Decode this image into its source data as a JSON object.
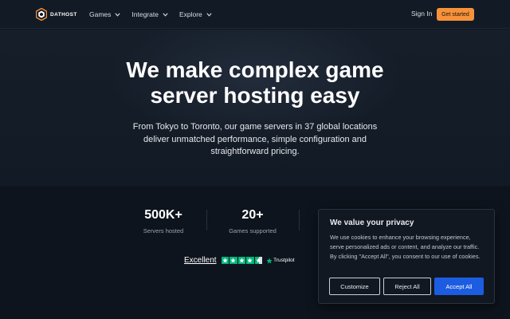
{
  "nav": {
    "brand": "DATHOST",
    "menu": [
      {
        "label": "Games"
      },
      {
        "label": "Integrate"
      },
      {
        "label": "Explore"
      }
    ],
    "sign_in": "Sign In",
    "get_started": "Get started"
  },
  "hero": {
    "title_line1": "We make complex game",
    "title_line2": "server hosting easy",
    "subtitle": "From Tokyo to Toronto, our game servers in 37 global locations deliver unmatched performance, simple configuration and straightforward pricing."
  },
  "stats": [
    {
      "value": "500K+",
      "label": "Servers hosted"
    },
    {
      "value": "20+",
      "label": "Games supported"
    }
  ],
  "trustpilot": {
    "rating_text": "Excellent",
    "brand": "Trustpilot",
    "stars_filled": 4.5,
    "stars_total": 5
  },
  "cookie": {
    "title": "We value your privacy",
    "text": "We use cookies to enhance your browsing experience, serve personalized ads or content, and analyze our traffic. By clicking \"Accept All\", you consent to our use of cookies.",
    "customize": "Customize",
    "reject": "Reject All",
    "accept": "Accept All"
  },
  "colors": {
    "accent_orange": "#f7923a",
    "accept_blue": "#1c5ce0",
    "trustpilot_green": "#00b67a",
    "background": "#0f1621"
  }
}
